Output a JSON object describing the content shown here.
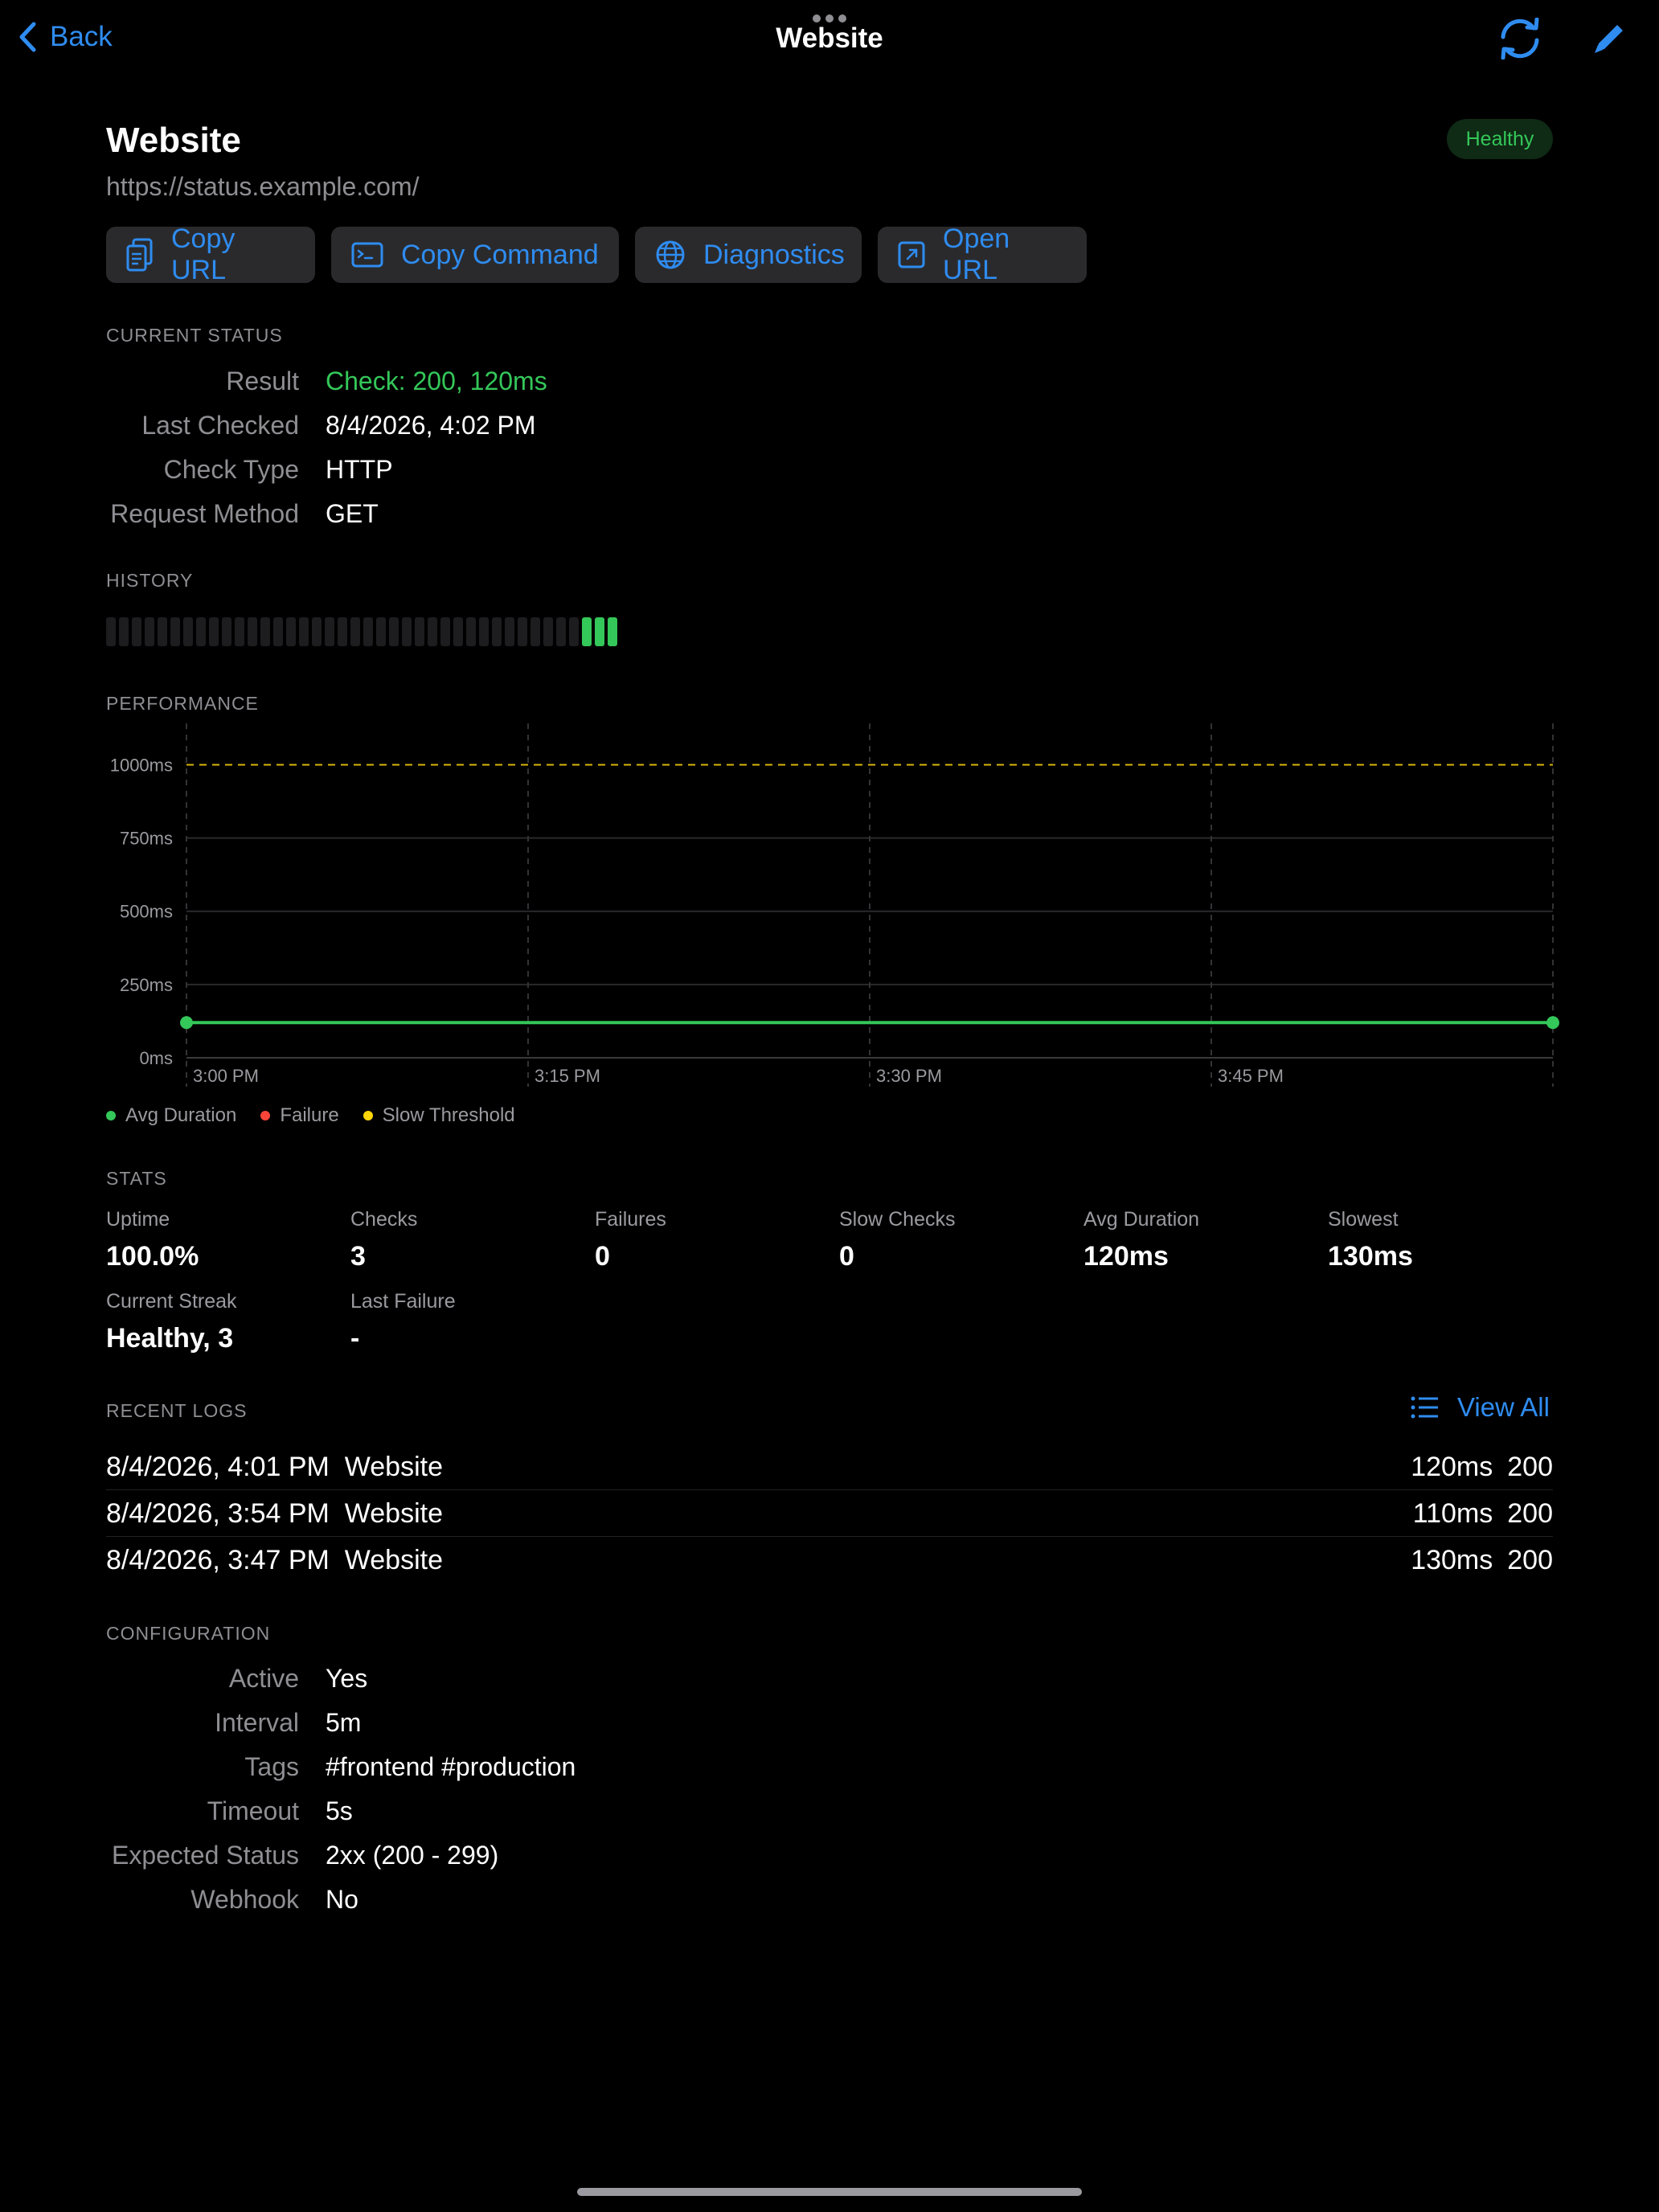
{
  "nav": {
    "back_label": "Back",
    "title": "Website",
    "icons": [
      "chevron-left-icon",
      "refresh-icon",
      "pencil-icon"
    ]
  },
  "header": {
    "title": "Website",
    "url": "https://status.example.com/",
    "badge": "Healthy"
  },
  "actions": [
    {
      "label": "Copy URL",
      "icon": "doc-copy-icon"
    },
    {
      "label": "Copy Command",
      "icon": "terminal-icon"
    },
    {
      "label": "Diagnostics",
      "icon": "globe-icon"
    },
    {
      "label": "Open URL",
      "icon": "open-external-icon"
    }
  ],
  "current_status": {
    "heading": "CURRENT STATUS",
    "rows": [
      {
        "label": "Result",
        "value": "Check: 200, 120ms"
      },
      {
        "label": "Last Checked",
        "value": "8/4/2026, 4:02 PM"
      },
      {
        "label": "Check Type",
        "value": "HTTP"
      },
      {
        "label": "Request Method",
        "value": "GET"
      }
    ]
  },
  "history": {
    "heading": "HISTORY",
    "total_slots": 40,
    "ok_slots": 3
  },
  "performance": {
    "heading": "PERFORMANCE",
    "legend": [
      {
        "label": "Avg Duration",
        "color": "#34c759"
      },
      {
        "label": "Failure",
        "color": "#ff453a"
      },
      {
        "label": "Slow Threshold",
        "color": "#ffd60a"
      }
    ]
  },
  "chart_data": {
    "type": "line",
    "x": [
      "3:00 PM",
      "4:00 PM"
    ],
    "x_ticks": [
      "3:00 PM",
      "3:15 PM",
      "3:30 PM",
      "3:45 PM"
    ],
    "y_ticks": [
      "0ms",
      "250ms",
      "500ms",
      "750ms",
      "1000ms"
    ],
    "ylim": [
      0,
      1100
    ],
    "series": [
      {
        "name": "Avg Duration",
        "values": [
          120,
          120
        ],
        "color": "#34c759"
      }
    ],
    "threshold": {
      "name": "Slow Threshold",
      "value": 1000,
      "color": "#ffd60a"
    },
    "grid": true
  },
  "stats": {
    "heading": "STATS",
    "items": [
      {
        "label": "Uptime",
        "value": "100.0%"
      },
      {
        "label": "Checks",
        "value": "3"
      },
      {
        "label": "Failures",
        "value": "0"
      },
      {
        "label": "Slow Checks",
        "value": "0"
      },
      {
        "label": "Avg Duration",
        "value": "120ms"
      },
      {
        "label": "Slowest",
        "value": "130ms"
      },
      {
        "label": "Current Streak",
        "value": "Healthy, 3"
      },
      {
        "label": "Last Failure",
        "value": "-"
      }
    ]
  },
  "logs": {
    "heading": "RECENT LOGS",
    "view_all": "View All",
    "rows": [
      {
        "time": "8/4/2026, 4:01 PM",
        "name": "Website",
        "duration": "120ms",
        "status": "200"
      },
      {
        "time": "8/4/2026, 3:54 PM",
        "name": "Website",
        "duration": "110ms",
        "status": "200"
      },
      {
        "time": "8/4/2026, 3:47 PM",
        "name": "Website",
        "duration": "130ms",
        "status": "200"
      }
    ]
  },
  "config": {
    "heading": "CONFIGURATION",
    "rows": [
      {
        "label": "Active",
        "value": "Yes"
      },
      {
        "label": "Interval",
        "value": "5m"
      },
      {
        "label": "Tags",
        "value": "#frontend #production"
      },
      {
        "label": "Timeout",
        "value": "5s"
      },
      {
        "label": "Expected Status",
        "value": "2xx (200 - 299)"
      },
      {
        "label": "Webhook",
        "value": "No"
      }
    ]
  }
}
